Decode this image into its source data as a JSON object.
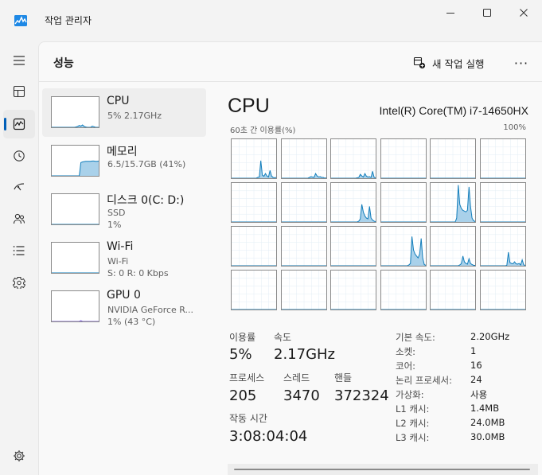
{
  "window": {
    "title": "작업 관리자",
    "colors": {
      "accent": "#005fb8",
      "graph_line": "#117dbb",
      "graph_fill": "#a9d1ea",
      "gpu_line": "#7b5bd6"
    }
  },
  "nav": [
    {
      "name": "hamburger-menu-icon"
    },
    {
      "name": "processes-icon"
    },
    {
      "name": "performance-icon"
    },
    {
      "name": "app-history-icon"
    },
    {
      "name": "startup-apps-icon"
    },
    {
      "name": "users-icon"
    },
    {
      "name": "details-icon"
    },
    {
      "name": "services-icon"
    },
    {
      "name": "settings-icon"
    }
  ],
  "header": {
    "title": "성능",
    "new_task_label": "새 작업 실행",
    "more_label": "···"
  },
  "resources": [
    {
      "name": "CPU",
      "line1": "5% 2.17GHz",
      "line2": ""
    },
    {
      "name": "메모리",
      "line1": "6.5/15.7GB (41%)",
      "line2": ""
    },
    {
      "name": "디스크 0(C: D:)",
      "line1": "SSD",
      "line2": "1%"
    },
    {
      "name": "Wi-Fi",
      "line1": "Wi-Fi",
      "line2": "S: 0 R: 0 Kbps"
    },
    {
      "name": "GPU 0",
      "line1": "NVIDIA GeForce R...",
      "line2": "1% (43 °C)"
    }
  ],
  "cpu": {
    "title": "CPU",
    "model": "Intel(R) Core(TM) i7-14650HX",
    "graph_label": "60초 간 이용률(%)",
    "graph_max": "100%",
    "stats": {
      "utilization_label": "이용률",
      "utilization": "5%",
      "speed_label": "속도",
      "speed": "2.17GHz",
      "processes_label": "프로세스",
      "processes": "205",
      "threads_label": "스레드",
      "threads": "3470",
      "handles_label": "핸들",
      "handles": "372324",
      "uptime_label": "작동 시간",
      "uptime": "3:08:04:04"
    },
    "specs": [
      {
        "label": "기본 속도:",
        "value": "2.20GHz"
      },
      {
        "label": "소켓:",
        "value": "1"
      },
      {
        "label": "코어:",
        "value": "16"
      },
      {
        "label": "논리 프로세서:",
        "value": "24"
      },
      {
        "label": "가상화:",
        "value": "사용"
      },
      {
        "label": "L1 캐시:",
        "value": "1.4MB"
      },
      {
        "label": "L2 캐시:",
        "value": "24.0MB"
      },
      {
        "label": "L3 캐시:",
        "value": "30.0MB"
      }
    ]
  },
  "mini_graphs": {
    "cpu": [
      0,
      0,
      0,
      0,
      0,
      0,
      0,
      0,
      0,
      0,
      0,
      0,
      0,
      0,
      0,
      1,
      3,
      6,
      4,
      8,
      3,
      1,
      0,
      0,
      0,
      4,
      2,
      0,
      0,
      0
    ],
    "memory": [
      0,
      0,
      0,
      0,
      0,
      0,
      0,
      0,
      0,
      0,
      0,
      0,
      0,
      0,
      0,
      0,
      0,
      0,
      44,
      46,
      47,
      48,
      48,
      48,
      48,
      49,
      49,
      48,
      48,
      49
    ],
    "disk": [
      0,
      0,
      0,
      0,
      0,
      0,
      0,
      0,
      0,
      0,
      0,
      0,
      0,
      0,
      0,
      0,
      0,
      0,
      0,
      0,
      0,
      0,
      0,
      0,
      0,
      0,
      0,
      0,
      0,
      0
    ],
    "wifi": [
      0,
      0,
      0,
      0,
      0,
      0,
      0,
      0,
      0,
      0,
      0,
      0,
      0,
      0,
      0,
      0,
      0,
      0,
      0,
      0,
      0,
      0,
      0,
      0,
      0,
      0,
      0,
      0,
      0,
      0
    ],
    "gpu": [
      0,
      0,
      0,
      0,
      0,
      0,
      0,
      0,
      0,
      0,
      0,
      0,
      0,
      0,
      0,
      0,
      0,
      0,
      3,
      0,
      0,
      0,
      0,
      0,
      0,
      0,
      0,
      0,
      0,
      0
    ]
  },
  "core_graphs": [
    [
      0,
      0,
      0,
      0,
      0,
      0,
      0,
      0,
      0,
      0,
      0,
      0,
      0,
      0,
      0,
      0,
      0,
      2,
      3,
      45,
      8,
      5,
      12,
      6,
      3,
      20,
      6,
      2,
      1,
      2
    ],
    [
      0,
      0,
      0,
      0,
      0,
      0,
      0,
      0,
      0,
      0,
      0,
      0,
      0,
      0,
      0,
      0,
      0,
      0,
      2,
      4,
      3,
      2,
      12,
      6,
      3,
      4,
      2,
      2,
      0,
      1
    ],
    [
      0,
      0,
      0,
      0,
      0,
      0,
      0,
      0,
      0,
      0,
      0,
      0,
      0,
      0,
      0,
      0,
      0,
      1,
      2,
      10,
      6,
      3,
      12,
      5,
      3,
      4,
      2,
      18,
      2,
      1
    ],
    [
      0,
      0,
      0,
      0,
      0,
      0,
      0,
      0,
      0,
      0,
      0,
      0,
      0,
      0,
      0,
      0,
      0,
      0,
      0,
      0,
      0,
      0,
      0,
      0,
      0,
      0,
      0,
      0,
      0,
      0
    ],
    [
      0,
      0,
      0,
      0,
      0,
      0,
      0,
      0,
      0,
      0,
      0,
      0,
      0,
      0,
      0,
      0,
      0,
      0,
      0,
      0,
      0,
      0,
      0,
      0,
      0,
      0,
      0,
      0,
      0,
      0
    ],
    [
      0,
      0,
      0,
      0,
      0,
      0,
      0,
      0,
      0,
      0,
      0,
      0,
      0,
      0,
      0,
      0,
      0,
      0,
      0,
      0,
      0,
      0,
      0,
      0,
      0,
      0,
      0,
      0,
      0,
      0
    ],
    [
      0,
      0,
      0,
      0,
      0,
      0,
      0,
      0,
      0,
      0,
      0,
      0,
      0,
      0,
      0,
      0,
      0,
      0,
      0,
      0,
      0,
      0,
      0,
      0,
      0,
      0,
      0,
      0,
      0,
      0
    ],
    [
      0,
      0,
      0,
      0,
      0,
      0,
      0,
      0,
      0,
      0,
      0,
      0,
      0,
      0,
      0,
      0,
      0,
      0,
      0,
      0,
      0,
      0,
      0,
      0,
      0,
      0,
      0,
      0,
      0,
      0
    ],
    [
      0,
      0,
      0,
      0,
      0,
      0,
      0,
      0,
      0,
      0,
      0,
      0,
      0,
      0,
      0,
      0,
      0,
      0,
      2,
      8,
      45,
      25,
      15,
      10,
      8,
      40,
      10,
      5,
      2,
      1
    ],
    [
      0,
      0,
      0,
      0,
      0,
      0,
      0,
      0,
      0,
      0,
      0,
      0,
      0,
      0,
      0,
      0,
      0,
      0,
      0,
      0,
      0,
      0,
      0,
      0,
      0,
      0,
      0,
      0,
      0,
      0
    ],
    [
      0,
      0,
      0,
      0,
      0,
      0,
      0,
      0,
      0,
      0,
      0,
      0,
      0,
      0,
      0,
      0,
      0,
      10,
      95,
      45,
      35,
      30,
      28,
      26,
      30,
      90,
      40,
      10,
      3,
      1
    ],
    [
      0,
      0,
      0,
      0,
      0,
      0,
      0,
      0,
      0,
      0,
      0,
      0,
      0,
      0,
      0,
      0,
      0,
      0,
      0,
      0,
      0,
      0,
      0,
      0,
      0,
      0,
      0,
      0,
      0,
      0
    ],
    [
      0,
      0,
      0,
      0,
      0,
      0,
      0,
      0,
      0,
      0,
      0,
      0,
      0,
      0,
      0,
      0,
      0,
      0,
      0,
      0,
      0,
      0,
      0,
      0,
      0,
      0,
      0,
      0,
      0,
      0
    ],
    [
      0,
      0,
      0,
      0,
      0,
      0,
      0,
      0,
      0,
      0,
      0,
      0,
      0,
      0,
      0,
      0,
      0,
      0,
      0,
      0,
      0,
      0,
      0,
      0,
      0,
      0,
      0,
      0,
      0,
      0
    ],
    [
      0,
      0,
      0,
      0,
      0,
      0,
      0,
      0,
      0,
      0,
      0,
      0,
      0,
      0,
      0,
      0,
      0,
      0,
      0,
      0,
      0,
      0,
      0,
      0,
      0,
      0,
      0,
      0,
      0,
      0
    ],
    [
      0,
      0,
      0,
      0,
      0,
      0,
      0,
      0,
      0,
      0,
      0,
      0,
      0,
      0,
      0,
      0,
      0,
      0,
      2,
      6,
      75,
      40,
      30,
      25,
      20,
      30,
      70,
      20,
      3,
      1
    ],
    [
      0,
      0,
      0,
      0,
      0,
      0,
      0,
      0,
      0,
      0,
      0,
      0,
      0,
      0,
      0,
      0,
      0,
      0,
      0,
      2,
      5,
      25,
      10,
      6,
      4,
      18,
      6,
      3,
      1,
      1
    ],
    [
      0,
      0,
      0,
      0,
      0,
      0,
      0,
      0,
      0,
      0,
      0,
      0,
      0,
      0,
      0,
      0,
      0,
      1,
      35,
      8,
      6,
      5,
      10,
      5,
      4,
      6,
      2,
      15,
      2,
      1
    ],
    [
      0,
      0,
      0,
      0,
      0,
      0,
      0,
      0,
      0,
      0,
      0,
      0,
      0,
      0,
      0,
      0,
      0,
      0,
      0,
      0,
      0,
      0,
      0,
      0,
      0,
      0,
      0,
      0,
      0,
      0
    ],
    [
      0,
      0,
      0,
      0,
      0,
      0,
      0,
      0,
      0,
      0,
      0,
      0,
      0,
      0,
      0,
      0,
      0,
      0,
      0,
      0,
      0,
      0,
      0,
      0,
      0,
      0,
      0,
      0,
      0,
      0
    ],
    [
      0,
      0,
      0,
      0,
      0,
      0,
      0,
      0,
      0,
      0,
      0,
      0,
      0,
      0,
      0,
      0,
      0,
      0,
      0,
      0,
      0,
      0,
      0,
      0,
      0,
      0,
      0,
      0,
      0,
      0
    ],
    [
      0,
      0,
      0,
      0,
      0,
      0,
      0,
      0,
      0,
      0,
      0,
      0,
      0,
      0,
      0,
      0,
      0,
      0,
      0,
      0,
      0,
      0,
      0,
      0,
      0,
      0,
      0,
      0,
      0,
      0
    ],
    [
      0,
      0,
      0,
      0,
      0,
      0,
      0,
      0,
      0,
      0,
      0,
      0,
      0,
      0,
      0,
      0,
      0,
      0,
      0,
      0,
      0,
      0,
      0,
      0,
      0,
      0,
      0,
      0,
      0,
      0
    ],
    [
      0,
      0,
      0,
      0,
      0,
      0,
      0,
      0,
      0,
      0,
      0,
      0,
      0,
      0,
      0,
      0,
      0,
      0,
      0,
      0,
      0,
      0,
      0,
      0,
      0,
      0,
      0,
      0,
      0,
      0
    ]
  ]
}
